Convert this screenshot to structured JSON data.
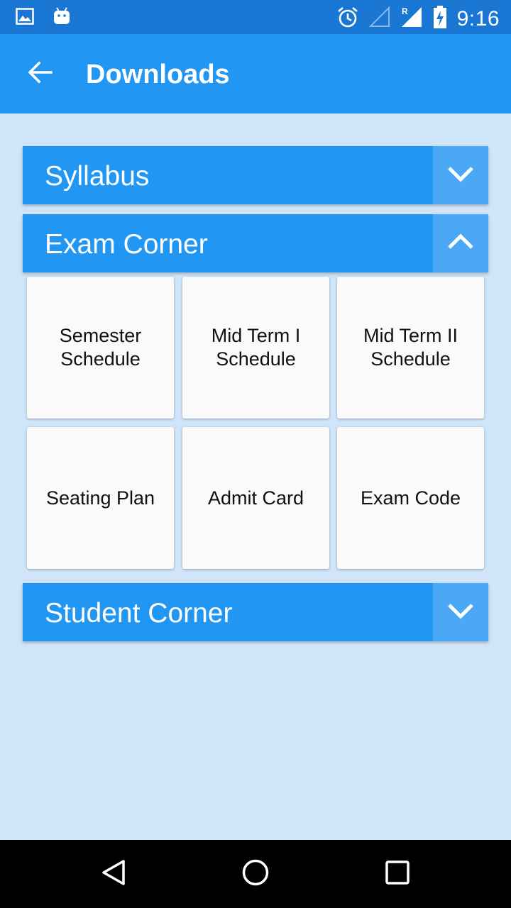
{
  "status_bar": {
    "time": "9:16",
    "left_icons": [
      "image-icon",
      "android-icon"
    ],
    "right_icons": [
      "alarm-icon",
      "signal-empty-icon",
      "signal-roaming-icon",
      "battery-charging-icon"
    ]
  },
  "app_bar": {
    "title": "Downloads",
    "back_icon": "arrow-back-icon"
  },
  "sections": [
    {
      "title": "Syllabus",
      "expanded": false,
      "toggle_icon": "chevron-down-icon"
    },
    {
      "title": "Exam Corner",
      "expanded": true,
      "toggle_icon": "chevron-up-icon",
      "items": [
        "Semester Schedule",
        "Mid Term I Schedule",
        "Mid Term II Schedule",
        "Seating Plan",
        "Admit Card",
        "Exam Code"
      ]
    },
    {
      "title": "Student Corner",
      "expanded": false,
      "toggle_icon": "chevron-down-icon"
    }
  ],
  "nav_bar": {
    "icons": [
      "back-triangle-icon",
      "home-circle-icon",
      "recents-square-icon"
    ]
  },
  "colors": {
    "status_bar": "#1976d2",
    "app_bar": "#2196f3",
    "background": "#d0e5f9",
    "section_header": "#2196f3",
    "toggle_bg": "#4aa8f6",
    "tile": "#fafafa"
  }
}
